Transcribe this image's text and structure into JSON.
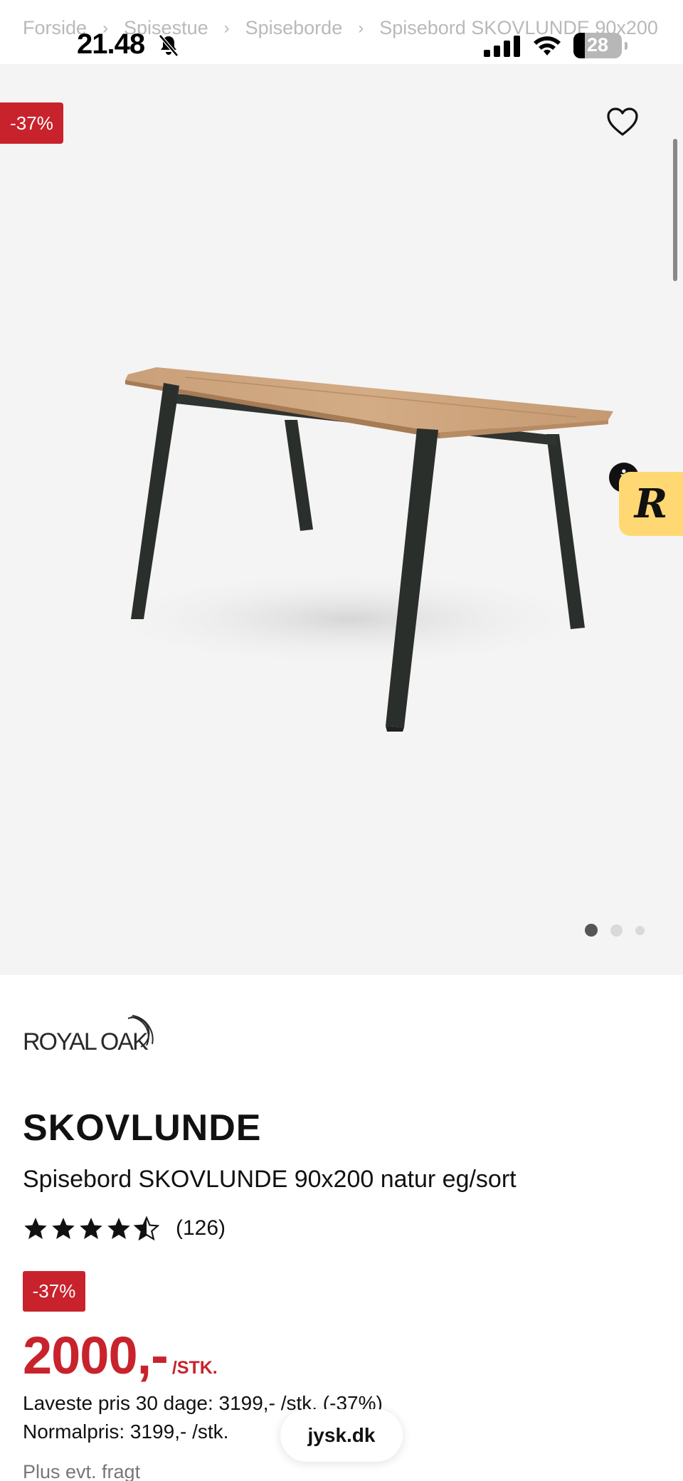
{
  "status_bar": {
    "time": "21.48",
    "battery_level": "28",
    "icons": [
      "bell-slash-icon",
      "cellular-signal-icon",
      "wifi-icon",
      "battery-icon"
    ]
  },
  "breadcrumb": {
    "items": [
      "Forside",
      "Spisestue",
      "Spiseborde",
      "Spisebord SKOVLUNDE 90x200"
    ]
  },
  "gallery": {
    "discount_badge": "-37%",
    "image_count": 3,
    "active_image": 1
  },
  "widget": {
    "label": "R",
    "info": "i"
  },
  "product": {
    "brand": "ROYAL OAK",
    "name": "SKOVLUNDE",
    "description": "Spisebord SKOVLUNDE 90x200 natur eg/sort",
    "rating": 4.5,
    "rating_max": 5,
    "rating_count": "(126)",
    "discount_badge": "-37%",
    "price": "2000,-",
    "price_unit": "/STK.",
    "lowest_price_line": "Laveste pris 30 dage: 3199,- /stk. (-37%)",
    "normal_price_line": "Normalpris: 3199,- /stk.",
    "freight_note": "Plus evt. fragt"
  },
  "browser": {
    "url": "jysk.dk"
  },
  "colors": {
    "sale_red": "#c8232c",
    "gallery_bg": "#f4f4f4",
    "widget_yellow": "#ffd874",
    "text": "#111111",
    "muted": "#b9b9b9"
  }
}
